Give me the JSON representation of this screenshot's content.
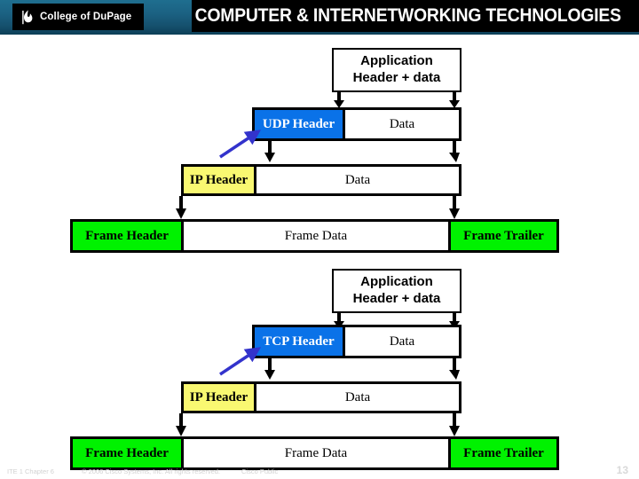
{
  "banner": {
    "title": "COMPUTER & INTERNETWORKING TECHNOLOGIES",
    "logo_text": "College of DuPage",
    "logo_icon": "flame-icon",
    "band_color": "#000000",
    "gradient_color": "#1b6182"
  },
  "diagrams": [
    {
      "id": "udp-encapsulation",
      "application": {
        "line1": "Application",
        "line2": "Header + data"
      },
      "transport": {
        "header_label": "UDP Header",
        "data_label": "Data",
        "header_color": "#0a72e8",
        "header_text_color": "#ffffff"
      },
      "network": {
        "header_label": "IP Header",
        "data_label": "Data",
        "header_color": "#f9f871",
        "header_text_color": "#000000"
      },
      "datalink": {
        "header_label": "Frame Header",
        "data_label": "Frame Data",
        "trailer_label": "Frame Trailer",
        "header_color": "#00f200",
        "trailer_color": "#00f200"
      },
      "pointer_arrow_color": "#3333cc"
    },
    {
      "id": "tcp-encapsulation",
      "application": {
        "line1": "Application",
        "line2": "Header + data"
      },
      "transport": {
        "header_label": "TCP Header",
        "data_label": "Data",
        "header_color": "#0a72e8",
        "header_text_color": "#ffffff"
      },
      "network": {
        "header_label": "IP Header",
        "data_label": "Data",
        "header_color": "#f9f871",
        "header_text_color": "#000000"
      },
      "datalink": {
        "header_label": "Frame Header",
        "data_label": "Frame Data",
        "trailer_label": "Frame Trailer",
        "header_color": "#00f200",
        "trailer_color": "#00f200"
      },
      "pointer_arrow_color": "#3333cc"
    }
  ],
  "footer": {
    "chapter": "ITE 1 Chapter 6",
    "copyright": "© 2006 Cisco Systems, Inc. All rights reserved.",
    "classification": "Cisco Public",
    "page_number": "13"
  }
}
